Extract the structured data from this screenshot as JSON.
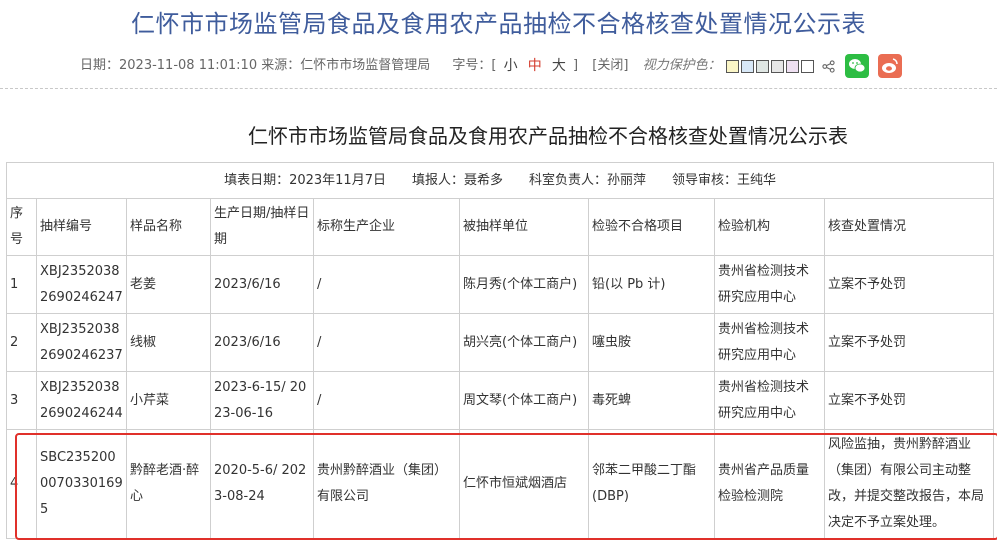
{
  "page": {
    "title": "仁怀市市场监管局食品及食用农产品抽检不合格核查处置情况公示表",
    "meta": {
      "date_label": "日期：",
      "date_value": "2023-11-08 11:01:10",
      "source_label": "来源：",
      "source_value": "仁怀市市场监督管理局",
      "font_label": "字号：[",
      "size_small": "小",
      "size_mid": "中",
      "size_large": "大",
      "font_close": "]",
      "close_label": "[关闭]",
      "eye_label": "视力保护色："
    },
    "swatch_colors": [
      "#fbf6c7",
      "#d8e8f7",
      "#dfe6e3",
      "#e6e6e6",
      "#efe0f2",
      "#ffffff"
    ],
    "share_colors": {
      "wechat": "#2dbd43",
      "weibo": "#ea6d53"
    }
  },
  "document": {
    "title": "仁怀市市场监管局食品及食用农产品抽检不合格核查处置情况公示表",
    "fill_info": "填表日期：2023年11月7日　　填报人：聂希多　　科室负责人：孙丽萍　　领导审核：王纯华",
    "columns": [
      "序号",
      "抽样编号",
      "样品名称",
      "生产日期/抽样日期",
      "标称生产企业",
      "被抽样单位",
      "检验不合格项目",
      "检验机构",
      "核查处置情况"
    ],
    "rows": [
      [
        "1",
        "XBJ23520382690246247",
        "老姜",
        "2023/6/16",
        "/",
        "陈月秀(个体工商户)",
        "铅(以 Pb 计)",
        "贵州省检测技术研究应用中心",
        "立案不予处罚"
      ],
      [
        "2",
        "XBJ23520382690246237",
        "线椒",
        "2023/6/16",
        "/",
        "胡兴亮(个体工商户)",
        "噻虫胺",
        "贵州省检测技术研究应用中心",
        "立案不予处罚"
      ],
      [
        "3",
        "XBJ23520382690246244",
        "小芹菜",
        "2023-6-15/ 2023-06-16",
        "/",
        "周文琴(个体工商户)",
        "毒死蜱",
        "贵州省检测技术研究应用中心",
        "立案不予处罚"
      ],
      [
        "4",
        "SBC23520000703301695",
        "黔醉老酒·醉心",
        "2020-5-6/ 2023-08-24",
        "贵州黔醉酒业（集团）有限公司",
        "仁怀市恒斌烟酒店",
        "邻苯二甲酸二丁酯(DBP)",
        "贵州省产品质量检验检测院",
        "风险监抽，贵州黔醉酒业（集团）有限公司主动整改，并提交整改报告，本局决定不予立案处理。"
      ]
    ]
  }
}
